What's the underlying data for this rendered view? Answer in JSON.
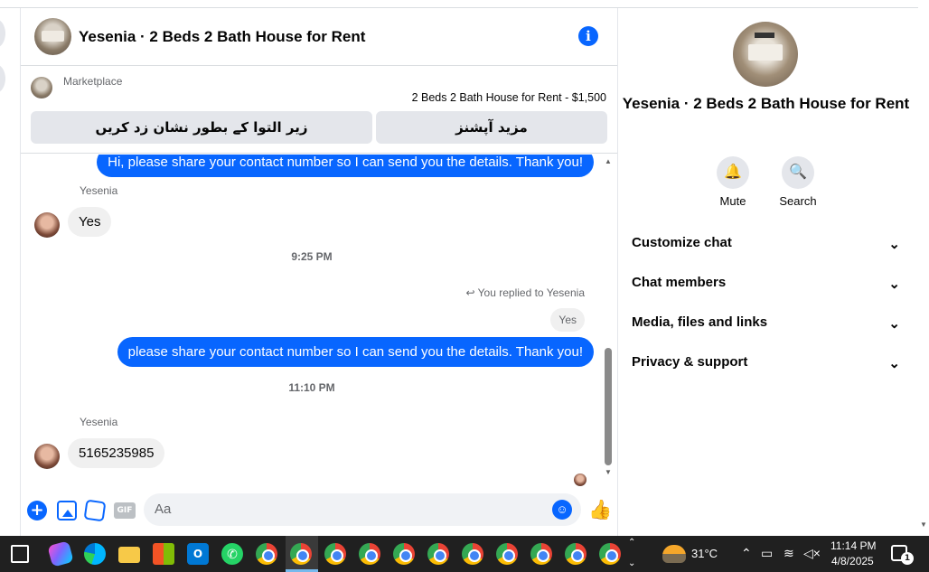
{
  "chat": {
    "title": "Yesenia · 2 Beds 2 Bath House for Rent",
    "marketplace_label": "Marketplace",
    "listing": "2 Beds 2 Bath House for Rent - $1,500",
    "mark_pending_button": "زیر التوا کے بطور نشان زد کریں",
    "more_options_button": "مزید آپشنز",
    "composer_placeholder": "Aa",
    "gif_label": "GIF"
  },
  "messages": {
    "outgoing_top": "Hi, please share your contact number so I can send you the details. Thank you!",
    "sender_1": "Yesenia",
    "reply_1": "Yes",
    "time_1": "9:25 PM",
    "replied_label": "You replied to Yesenia",
    "quoted_text": "Yes",
    "outgoing_reply": "please share your contact number so I can send you the details. Thank you!",
    "time_2": "11:10 PM",
    "sender_2": "Yesenia",
    "phone": "5165235985"
  },
  "details": {
    "title": "Yesenia · 2 Beds 2 Bath House for Rent",
    "mute_label": "Mute",
    "search_label": "Search",
    "sections": [
      "Customize chat",
      "Chat members",
      "Media, files and links",
      "Privacy & support"
    ]
  },
  "taskbar": {
    "temperature": "31°C",
    "time": "11:14 PM",
    "date": "4/8/2025",
    "notification_count": "1",
    "outlook_letter": "O",
    "app_icons": [
      "task-view-icon",
      "copilot-icon",
      "edge-icon",
      "file-explorer-icon",
      "microsoft-store-icon",
      "outlook-icon",
      "whatsapp-icon",
      "chrome-icon"
    ]
  },
  "colors": {
    "accent": "#0866ff",
    "incoming_bubble": "#f0f0f0",
    "button_bg": "#e4e6eb",
    "taskbar": "#202020"
  }
}
